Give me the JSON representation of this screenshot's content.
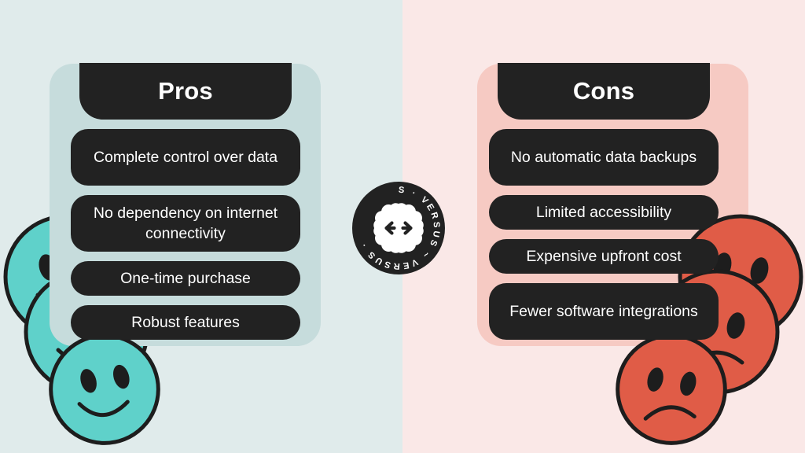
{
  "theme": {
    "bg_left": "#e0ebeb",
    "bg_right": "#fae8e7",
    "panel_left": "#c6dcdc",
    "panel_right": "#f6cac3",
    "pill_bg": "#222222",
    "pill_text": "#ffffff",
    "face_happy": "#5fd1ca",
    "face_sad": "#e05c47",
    "outline": "#1d1d1d"
  },
  "pros": {
    "heading": "Pros",
    "items": [
      {
        "text": "Complete control over data",
        "lines": 2
      },
      {
        "text": "No dependency on internet connectivity",
        "lines": 2
      },
      {
        "text": "One-time purchase",
        "lines": 1
      },
      {
        "text": "Robust features",
        "lines": 1
      }
    ]
  },
  "cons": {
    "heading": "Cons",
    "items": [
      {
        "text": "No automatic data backups",
        "lines": 2
      },
      {
        "text": "Limited accessibility",
        "lines": 1
      },
      {
        "text": "Expensive upfront cost",
        "lines": 1
      },
      {
        "text": "Fewer software integrations",
        "lines": 2
      }
    ]
  },
  "badge": {
    "ring_text": "VERSUS · VERSUS ~ VERSUS ·",
    "inner_icon": "double-arrow-outward-icon"
  },
  "decorations": {
    "happy_faces_count": 3,
    "sad_faces_count": 3,
    "happy_icon": "smiley-face-icon",
    "sad_icon": "frowning-face-icon"
  }
}
